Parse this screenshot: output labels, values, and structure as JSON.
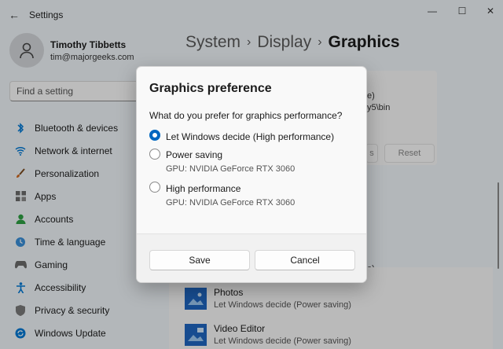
{
  "window": {
    "title": "Settings",
    "controls": {
      "minimize": "—",
      "maximize": "☐",
      "close": "✕"
    }
  },
  "profile": {
    "name": "Timothy Tibbetts",
    "email": "tim@majorgeeks.com"
  },
  "search": {
    "placeholder": "Find a setting"
  },
  "sidebar": {
    "items": [
      {
        "label": "Bluetooth & devices",
        "icon": "bluetooth-icon",
        "color": "#0078d4"
      },
      {
        "label": "Network & internet",
        "icon": "wifi-icon",
        "color": "#0078d4"
      },
      {
        "label": "Personalization",
        "icon": "brush-icon",
        "color": "#d2691e"
      },
      {
        "label": "Apps",
        "icon": "apps-icon",
        "color": "#5a5a5a"
      },
      {
        "label": "Accounts",
        "icon": "person-icon",
        "color": "#2ea043"
      },
      {
        "label": "Time & language",
        "icon": "globe-clock-icon",
        "color": "#0078d4"
      },
      {
        "label": "Gaming",
        "icon": "controller-icon",
        "color": "#5a5a5a"
      },
      {
        "label": "Accessibility",
        "icon": "accessibility-icon",
        "color": "#0078d4"
      },
      {
        "label": "Privacy & security",
        "icon": "shield-icon",
        "color": "#5a5a5a"
      },
      {
        "label": "Windows Update",
        "icon": "update-icon",
        "color": "#0078d4"
      }
    ]
  },
  "breadcrumb": {
    "items": [
      "System",
      "Display"
    ],
    "current": "Graphics",
    "separator": "›"
  },
  "background_card": {
    "line1": "e)",
    "line2": "y5\\bin",
    "button_partial": "s",
    "reset_label": "Reset",
    "behind_dialog_text": "e)"
  },
  "app_list": [
    {
      "name": "Photos",
      "setting": "Let Windows decide (Power saving)"
    },
    {
      "name": "Video Editor",
      "setting": "Let Windows decide (Power saving)"
    }
  ],
  "dialog": {
    "title": "Graphics preference",
    "question": "What do you prefer for graphics performance?",
    "options": [
      {
        "label": "Let Windows decide (High performance)",
        "sub": "",
        "selected": true
      },
      {
        "label": "Power saving",
        "sub": "GPU: NVIDIA GeForce RTX 3060",
        "selected": false
      },
      {
        "label": "High performance",
        "sub": "GPU: NVIDIA GeForce RTX 3060",
        "selected": false
      }
    ],
    "save_label": "Save",
    "cancel_label": "Cancel"
  },
  "colors": {
    "accent": "#0067c0",
    "overlay": "rgba(0,0,0,0.25)"
  }
}
